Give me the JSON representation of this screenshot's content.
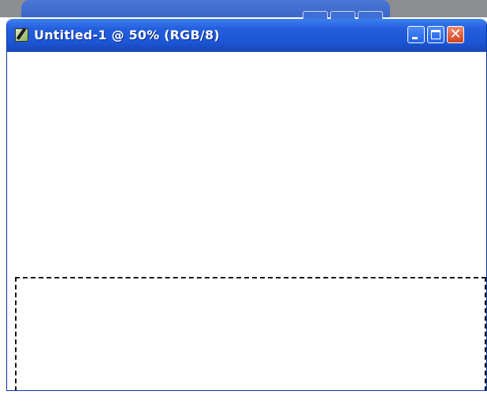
{
  "window": {
    "title": "Untitled-1 @ 50% (RGB/8)",
    "app_icon": "document-brush-icon",
    "buttons": [
      {
        "name": "minimize-button",
        "icon": "minimize-icon"
      },
      {
        "name": "maximize-button",
        "icon": "maximize-icon"
      },
      {
        "name": "close-button",
        "icon": "close-icon",
        "glyph": "✕"
      }
    ]
  },
  "canvas": {
    "background": "#ffffff",
    "selection_tool": "rectangular-marquee"
  },
  "colors": {
    "titlebar_blue": "#245edc",
    "close_red": "#d4431f",
    "selection_border": "#111111"
  }
}
